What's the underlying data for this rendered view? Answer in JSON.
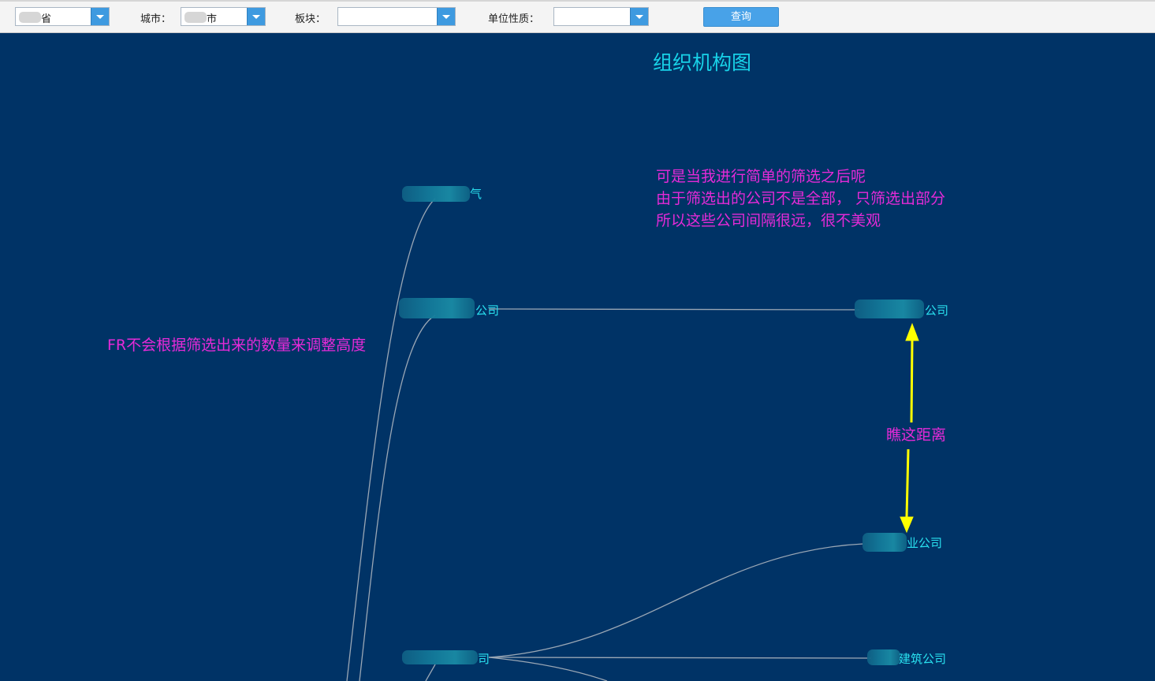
{
  "toolbar": {
    "province_label": "",
    "province_value": "省",
    "city_label": "城市：",
    "city_value": "市",
    "sector_label": "板块：",
    "sector_value": "",
    "unit_label": "单位性质：",
    "unit_value": "",
    "query_button": "查询"
  },
  "chart": {
    "title": "组织机构图",
    "nodes": [
      {
        "id": "n1",
        "label": "气"
      },
      {
        "id": "n2",
        "label": "公司"
      },
      {
        "id": "n3",
        "label": "公司"
      },
      {
        "id": "n4",
        "label": "业公司"
      },
      {
        "id": "n5",
        "label": "司"
      },
      {
        "id": "n6",
        "label": "建筑公司"
      }
    ]
  },
  "annotations": {
    "top_note_line1": "可是当我进行简单的筛选之后呢",
    "top_note_line2": "由于筛选出的公司不是全部， 只筛选出部分",
    "top_note_line3": "所以这些公司间隔很远，很不美观",
    "left_note": "FR不会根据筛选出来的数量来调整高度",
    "distance_note": "瞧这距离"
  },
  "colors": {
    "background": "#003366",
    "title": "#18d2e8",
    "node_text": "#29e0ef",
    "annotation": "#e62ad8",
    "arrow": "#ffff00",
    "link": "#9aa7b5"
  }
}
